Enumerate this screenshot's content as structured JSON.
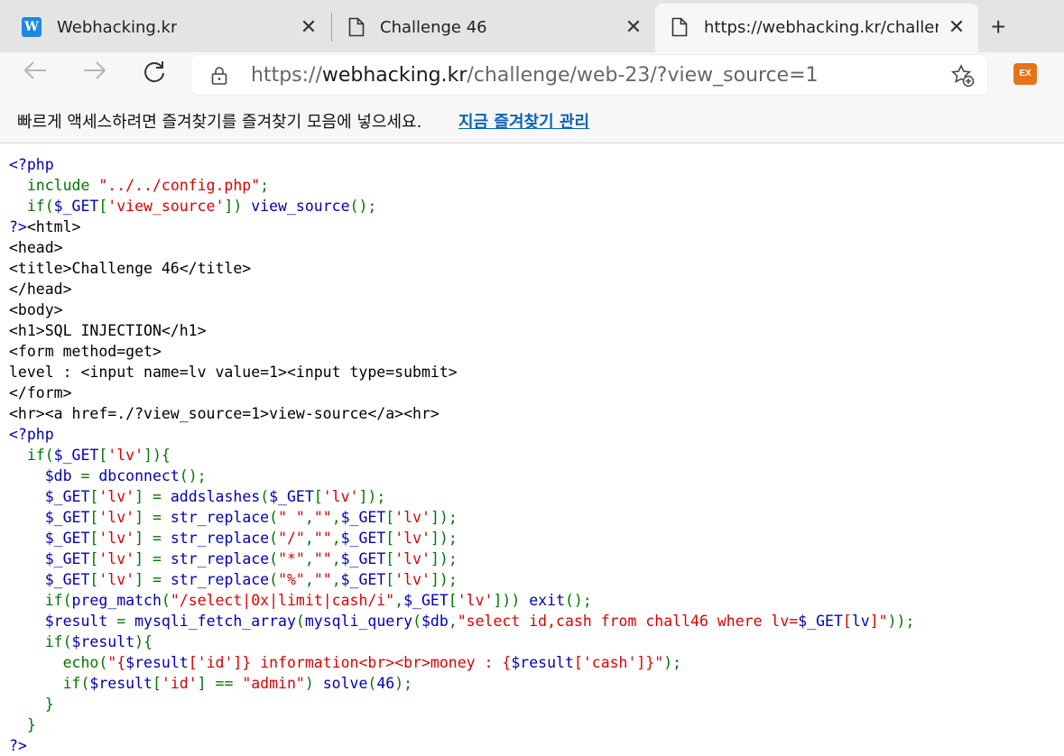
{
  "tabs": [
    {
      "title": "Webhacking.kr",
      "icon": "w-logo-icon"
    },
    {
      "title": "Challenge 46",
      "icon": "document-icon"
    },
    {
      "title": "https://webhacking.kr/challenge/",
      "icon": "document-icon",
      "active": true
    }
  ],
  "address": {
    "url_scheme": "https://",
    "url_domain": "webhacking.kr",
    "url_path": "/challenge/web-23/?view_source=1"
  },
  "extension_label": "EX",
  "favorites_bar": {
    "message": "빠르게 액세스하려면 즐겨찾기를 즐겨찾기 모음에 넣으세요.",
    "link": "지금 즐겨찾기 관리"
  },
  "colors": {
    "blue": "#0000bb",
    "green": "#007700",
    "red": "#dd0000",
    "black": "#000000"
  },
  "code_lines": [
    [
      {
        "t": "<?php",
        "c": "blue"
      }
    ],
    [
      {
        "t": "  include ",
        "c": "green"
      },
      {
        "t": "\"../../config.php\"",
        "c": "red"
      },
      {
        "t": ";",
        "c": "green"
      }
    ],
    [
      {
        "t": "  if(",
        "c": "green"
      },
      {
        "t": "$_GET",
        "c": "blue"
      },
      {
        "t": "[",
        "c": "green"
      },
      {
        "t": "'view_source'",
        "c": "red"
      },
      {
        "t": "]) ",
        "c": "green"
      },
      {
        "t": "view_source",
        "c": "blue"
      },
      {
        "t": "();",
        "c": "green"
      }
    ],
    [
      {
        "t": "?>",
        "c": "blue"
      },
      {
        "t": "<html>",
        "c": "black"
      }
    ],
    [
      {
        "t": "<head>",
        "c": "black"
      }
    ],
    [
      {
        "t": "<title>Challenge 46</title>",
        "c": "black"
      }
    ],
    [
      {
        "t": "</head>",
        "c": "black"
      }
    ],
    [
      {
        "t": "<body>",
        "c": "black"
      }
    ],
    [
      {
        "t": "<h1>SQL INJECTION</h1>",
        "c": "black"
      }
    ],
    [
      {
        "t": "<form method=get>",
        "c": "black"
      }
    ],
    [
      {
        "t": "level : <input name=lv value=1><input type=submit>",
        "c": "black"
      }
    ],
    [
      {
        "t": "</form>",
        "c": "black"
      }
    ],
    [
      {
        "t": "<hr><a href=./?view_source=1>view-source</a><hr>",
        "c": "black"
      }
    ],
    [
      {
        "t": "<?php",
        "c": "blue"
      }
    ],
    [
      {
        "t": "  if(",
        "c": "green"
      },
      {
        "t": "$_GET",
        "c": "blue"
      },
      {
        "t": "[",
        "c": "green"
      },
      {
        "t": "'lv'",
        "c": "red"
      },
      {
        "t": "]){",
        "c": "green"
      }
    ],
    [
      {
        "t": "    $db ",
        "c": "blue"
      },
      {
        "t": "= ",
        "c": "green"
      },
      {
        "t": "dbconnect",
        "c": "blue"
      },
      {
        "t": "();",
        "c": "green"
      }
    ],
    [
      {
        "t": "    $_GET",
        "c": "blue"
      },
      {
        "t": "[",
        "c": "green"
      },
      {
        "t": "'lv'",
        "c": "red"
      },
      {
        "t": "] = ",
        "c": "green"
      },
      {
        "t": "addslashes",
        "c": "blue"
      },
      {
        "t": "(",
        "c": "green"
      },
      {
        "t": "$_GET",
        "c": "blue"
      },
      {
        "t": "[",
        "c": "green"
      },
      {
        "t": "'lv'",
        "c": "red"
      },
      {
        "t": "]);",
        "c": "green"
      }
    ],
    [
      {
        "t": "    $_GET",
        "c": "blue"
      },
      {
        "t": "[",
        "c": "green"
      },
      {
        "t": "'lv'",
        "c": "red"
      },
      {
        "t": "] = ",
        "c": "green"
      },
      {
        "t": "str_replace",
        "c": "blue"
      },
      {
        "t": "(",
        "c": "green"
      },
      {
        "t": "\" \"",
        "c": "red"
      },
      {
        "t": ",",
        "c": "green"
      },
      {
        "t": "\"\"",
        "c": "red"
      },
      {
        "t": ",",
        "c": "green"
      },
      {
        "t": "$_GET",
        "c": "blue"
      },
      {
        "t": "[",
        "c": "green"
      },
      {
        "t": "'lv'",
        "c": "red"
      },
      {
        "t": "]);",
        "c": "green"
      }
    ],
    [
      {
        "t": "    $_GET",
        "c": "blue"
      },
      {
        "t": "[",
        "c": "green"
      },
      {
        "t": "'lv'",
        "c": "red"
      },
      {
        "t": "] = ",
        "c": "green"
      },
      {
        "t": "str_replace",
        "c": "blue"
      },
      {
        "t": "(",
        "c": "green"
      },
      {
        "t": "\"/\"",
        "c": "red"
      },
      {
        "t": ",",
        "c": "green"
      },
      {
        "t": "\"\"",
        "c": "red"
      },
      {
        "t": ",",
        "c": "green"
      },
      {
        "t": "$_GET",
        "c": "blue"
      },
      {
        "t": "[",
        "c": "green"
      },
      {
        "t": "'lv'",
        "c": "red"
      },
      {
        "t": "]);",
        "c": "green"
      }
    ],
    [
      {
        "t": "    $_GET",
        "c": "blue"
      },
      {
        "t": "[",
        "c": "green"
      },
      {
        "t": "'lv'",
        "c": "red"
      },
      {
        "t": "] = ",
        "c": "green"
      },
      {
        "t": "str_replace",
        "c": "blue"
      },
      {
        "t": "(",
        "c": "green"
      },
      {
        "t": "\"*\"",
        "c": "red"
      },
      {
        "t": ",",
        "c": "green"
      },
      {
        "t": "\"\"",
        "c": "red"
      },
      {
        "t": ",",
        "c": "green"
      },
      {
        "t": "$_GET",
        "c": "blue"
      },
      {
        "t": "[",
        "c": "green"
      },
      {
        "t": "'lv'",
        "c": "red"
      },
      {
        "t": "]);",
        "c": "green"
      }
    ],
    [
      {
        "t": "    $_GET",
        "c": "blue"
      },
      {
        "t": "[",
        "c": "green"
      },
      {
        "t": "'lv'",
        "c": "red"
      },
      {
        "t": "] = ",
        "c": "green"
      },
      {
        "t": "str_replace",
        "c": "blue"
      },
      {
        "t": "(",
        "c": "green"
      },
      {
        "t": "\"%\"",
        "c": "red"
      },
      {
        "t": ",",
        "c": "green"
      },
      {
        "t": "\"\"",
        "c": "red"
      },
      {
        "t": ",",
        "c": "green"
      },
      {
        "t": "$_GET",
        "c": "blue"
      },
      {
        "t": "[",
        "c": "green"
      },
      {
        "t": "'lv'",
        "c": "red"
      },
      {
        "t": "]);",
        "c": "green"
      }
    ],
    [
      {
        "t": "    if(",
        "c": "green"
      },
      {
        "t": "preg_match",
        "c": "blue"
      },
      {
        "t": "(",
        "c": "green"
      },
      {
        "t": "\"/select|0x|limit|cash/i\"",
        "c": "red"
      },
      {
        "t": ",",
        "c": "green"
      },
      {
        "t": "$_GET",
        "c": "blue"
      },
      {
        "t": "[",
        "c": "green"
      },
      {
        "t": "'lv'",
        "c": "red"
      },
      {
        "t": "])) ",
        "c": "green"
      },
      {
        "t": "exit",
        "c": "blue"
      },
      {
        "t": "();",
        "c": "green"
      }
    ],
    [
      {
        "t": "    $result ",
        "c": "blue"
      },
      {
        "t": "= ",
        "c": "green"
      },
      {
        "t": "mysqli_fetch_array",
        "c": "blue"
      },
      {
        "t": "(",
        "c": "green"
      },
      {
        "t": "mysqli_query",
        "c": "blue"
      },
      {
        "t": "(",
        "c": "green"
      },
      {
        "t": "$db",
        "c": "blue"
      },
      {
        "t": ",",
        "c": "green"
      },
      {
        "t": "\"select id,cash from chall46 where lv=",
        "c": "red"
      },
      {
        "t": "$_GET",
        "c": "blue"
      },
      {
        "t": "[",
        "c": "red"
      },
      {
        "t": "lv",
        "c": "blue"
      },
      {
        "t": "]\"",
        "c": "red"
      },
      {
        "t": "));",
        "c": "green"
      }
    ],
    [
      {
        "t": "    if(",
        "c": "green"
      },
      {
        "t": "$result",
        "c": "blue"
      },
      {
        "t": "){",
        "c": "green"
      }
    ],
    [
      {
        "t": "      echo(",
        "c": "green"
      },
      {
        "t": "\"{",
        "c": "red"
      },
      {
        "t": "$result",
        "c": "blue"
      },
      {
        "t": "[",
        "c": "red"
      },
      {
        "t": "'id'",
        "c": "red"
      },
      {
        "t": "]} information<br><br>money : {",
        "c": "red"
      },
      {
        "t": "$result",
        "c": "blue"
      },
      {
        "t": "['cash']}\"",
        "c": "red"
      },
      {
        "t": ");",
        "c": "green"
      }
    ],
    [
      {
        "t": "      if(",
        "c": "green"
      },
      {
        "t": "$result",
        "c": "blue"
      },
      {
        "t": "[",
        "c": "green"
      },
      {
        "t": "'id'",
        "c": "red"
      },
      {
        "t": "] == ",
        "c": "green"
      },
      {
        "t": "\"admin\"",
        "c": "red"
      },
      {
        "t": ") ",
        "c": "green"
      },
      {
        "t": "solve",
        "c": "blue"
      },
      {
        "t": "(",
        "c": "green"
      },
      {
        "t": "46",
        "c": "blue"
      },
      {
        "t": ");",
        "c": "green"
      }
    ],
    [
      {
        "t": "    }",
        "c": "green"
      }
    ],
    [
      {
        "t": "  }",
        "c": "green"
      }
    ],
    [
      {
        "t": "?>",
        "c": "blue"
      }
    ]
  ]
}
